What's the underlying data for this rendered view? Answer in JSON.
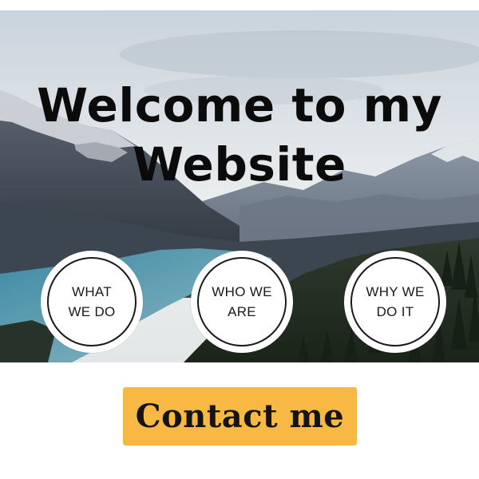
{
  "hero": {
    "title_line1": "Welcome to my",
    "title_line2": "Website"
  },
  "nav": {
    "what": [
      "WHAT",
      "WE DO"
    ],
    "who": [
      "WHO WE",
      "ARE"
    ],
    "why": [
      "WHY WE",
      "DO IT"
    ]
  },
  "cta": {
    "label": "Contact me"
  },
  "colors": {
    "cta_background": "#f7b944",
    "title_text": "#0b0b0b",
    "circle_border": "#1a1a1a",
    "page_background": "#ffffff"
  }
}
